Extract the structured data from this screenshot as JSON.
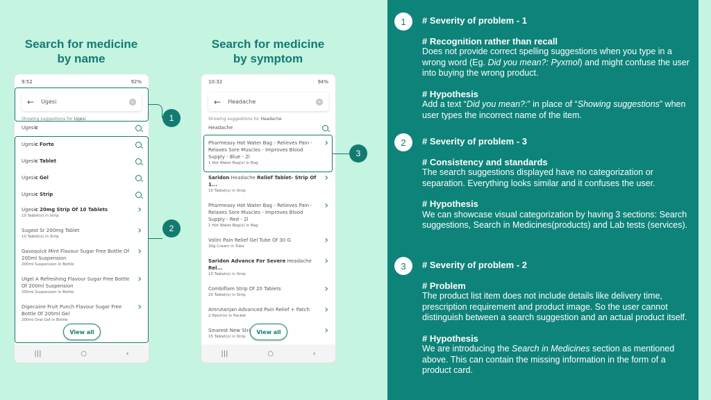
{
  "titles": {
    "left": "Search for medicine\nby name",
    "right": "Search for medicine\nby symptom"
  },
  "phone1": {
    "time": "9:52",
    "battery": "92%",
    "query": "Ugesi",
    "hint_prefix": "Showing suggestions for",
    "hint_term": "Ugesi",
    "suggestions": [
      {
        "parts": [
          [
            "Ugesi",
            0
          ],
          [
            "c",
            1
          ]
        ]
      },
      {
        "parts": [
          [
            "Ugesi",
            0
          ],
          [
            "c Forte",
            1
          ]
        ]
      },
      {
        "parts": [
          [
            "Ugesi",
            0
          ],
          [
            "c Tablet",
            1
          ]
        ]
      },
      {
        "parts": [
          [
            "Ugesi",
            0
          ],
          [
            "c Gel",
            1
          ]
        ]
      },
      {
        "parts": [
          [
            "Ugesi",
            0
          ],
          [
            "c Strip",
            1
          ]
        ]
      }
    ],
    "products": [
      {
        "parts": [
          [
            "Ugesi",
            0
          ],
          [
            "c 20mg Strip Of 10 Tablets",
            1
          ]
        ],
        "sub": "10 Tablet(s) in Strip"
      },
      {
        "parts": [
          [
            "Sugest Sr 200mg Tablet",
            0
          ]
        ],
        "sub": "10 Tablet(s) in Strip"
      },
      {
        "parts": [
          [
            "Gasoquick Mint Flavour Sugar Free Bottle Of 200ml Suspension",
            0
          ]
        ],
        "sub": "200ml Suspension in Bottle"
      },
      {
        "parts": [
          [
            "Ulgel A Refreshing Flavour Sugar Free Bottle Of 200ml Suspension",
            0
          ]
        ],
        "sub": "200ml Suspension in Bottle"
      },
      {
        "parts": [
          [
            "Digecaine Fruit Punch Flavour Sugar Free Bottle Of 200ml Gel",
            0
          ]
        ],
        "sub": "200ml Oral Gel in Bottle"
      }
    ],
    "view_all": "View all"
  },
  "phone2": {
    "time": "10:32",
    "battery": "94%",
    "query": "Headache",
    "hint_prefix": "Showing suggestions for",
    "hint_term": "Headache",
    "suggestions": [
      {
        "parts": [
          [
            "Headache",
            0
          ]
        ]
      }
    ],
    "products": [
      {
        "parts": [
          [
            "Pharmeasy Hot Water Bag - Relieves Pain - Relaxes Sore Muscles - Improves Blood Supply - Blue - 2l",
            0
          ]
        ],
        "sub": "1 Hot Water Bag(s) in Bag"
      },
      {
        "parts": [
          [
            "Saridon",
            1
          ],
          [
            " Headache ",
            0
          ],
          [
            "Relief Tablet- Strip Of 1...",
            1
          ]
        ],
        "sub": "10 Tablet(s) in Strip"
      },
      {
        "parts": [
          [
            "Pharmeasy Hot Water Bag - Relieves Pain - Relaxes Sore Muscles - Improves Blood Supply - Red - 2l",
            0
          ]
        ],
        "sub": "1 Hot Water Bag(s) in Bag"
      },
      {
        "parts": [
          [
            "Volini Pain Relief Gel Tube Of 30 G",
            0
          ]
        ],
        "sub": "30g Cream in Tube"
      },
      {
        "parts": [
          [
            "Saridon Advance For Severe",
            1
          ],
          [
            " Headache ",
            0
          ],
          [
            "Rel...",
            1
          ]
        ],
        "sub": "10 Tablet(s) in Strip"
      },
      {
        "parts": [
          [
            "Combiflam Strip Of 20 Tablets",
            0
          ]
        ],
        "sub": "20 Tablet(s) in Strip"
      },
      {
        "parts": [
          [
            "Amrutanjan Advanced Pain Relief + Patch",
            0
          ]
        ],
        "sub": "2 Patch(s) in Packet"
      },
      {
        "parts": [
          [
            "Sinarest New Strip Of 15 Tablets",
            0
          ]
        ],
        "sub": "15 Tablet(s) in Strip"
      }
    ],
    "view_all": "View all"
  },
  "badges": [
    "1",
    "2",
    "3"
  ],
  "sections": [
    {
      "num": "1",
      "blocks": [
        {
          "h": "# Severity of problem - 1",
          "p": []
        },
        {
          "h": "# Recognition rather than recall",
          "p": [
            [
              "Does not provide correct spelling suggestions when you type in a wrong word (Eg. ",
              0
            ],
            [
              "Did you mean?: Pyxmol",
              1
            ],
            [
              ") and might confuse the user into buying the wrong product.",
              0
            ]
          ]
        },
        {
          "h": "# Hypothesis",
          "p": [
            [
              "Add a text “",
              0
            ],
            [
              "Did you mean?:",
              1
            ],
            [
              "” in place of “",
              0
            ],
            [
              "Showing suggestions",
              1
            ],
            [
              "” when user types the incorrect name of the item.",
              0
            ]
          ]
        }
      ]
    },
    {
      "num": "2",
      "blocks": [
        {
          "h": "# Severity of problem - 3",
          "p": []
        },
        {
          "h": "# Consistency and standards",
          "p": [
            [
              "The search suggestions displayed have no categorization or separation. Everything looks similar and it confuses the user.",
              0
            ]
          ]
        },
        {
          "h": "# Hypothesis",
          "p": [
            [
              "We can showcase visual categorization by having 3 sections: Search suggestions, Search in Medicines(products) and Lab tests (services).",
              0
            ]
          ]
        }
      ]
    },
    {
      "num": "3",
      "blocks": [
        {
          "h": "# Severity of problem - 2",
          "p": []
        },
        {
          "h": "# Problem",
          "p": [
            [
              "The product list item does not include details like delivery time, prescription requirement and product image. So the user cannot distinguish between a search suggestion and an actual product itself.",
              0
            ]
          ]
        },
        {
          "h": "# Hypothesis",
          "p": [
            [
              "We are introducing the ",
              0
            ],
            [
              "Search in Medicines",
              1
            ],
            [
              " section as mentioned above. This can contain the missing information in the form of a product card.",
              0
            ]
          ]
        }
      ]
    }
  ],
  "colors": {
    "accent": "#137a72",
    "panel": "#0e837a",
    "background": "#c5f4e0"
  }
}
